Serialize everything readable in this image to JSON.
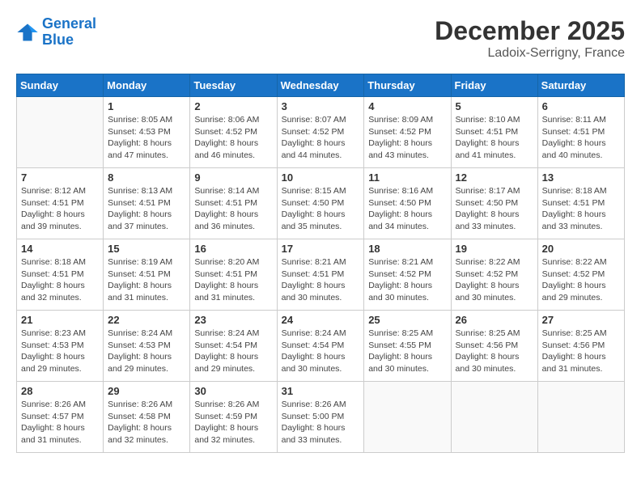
{
  "header": {
    "logo_line1": "General",
    "logo_line2": "Blue",
    "month": "December 2025",
    "location": "Ladoix-Serrigny, France"
  },
  "weekdays": [
    "Sunday",
    "Monday",
    "Tuesday",
    "Wednesday",
    "Thursday",
    "Friday",
    "Saturday"
  ],
  "weeks": [
    [
      {
        "day": "",
        "info": ""
      },
      {
        "day": "1",
        "info": "Sunrise: 8:05 AM\nSunset: 4:53 PM\nDaylight: 8 hours\nand 47 minutes."
      },
      {
        "day": "2",
        "info": "Sunrise: 8:06 AM\nSunset: 4:52 PM\nDaylight: 8 hours\nand 46 minutes."
      },
      {
        "day": "3",
        "info": "Sunrise: 8:07 AM\nSunset: 4:52 PM\nDaylight: 8 hours\nand 44 minutes."
      },
      {
        "day": "4",
        "info": "Sunrise: 8:09 AM\nSunset: 4:52 PM\nDaylight: 8 hours\nand 43 minutes."
      },
      {
        "day": "5",
        "info": "Sunrise: 8:10 AM\nSunset: 4:51 PM\nDaylight: 8 hours\nand 41 minutes."
      },
      {
        "day": "6",
        "info": "Sunrise: 8:11 AM\nSunset: 4:51 PM\nDaylight: 8 hours\nand 40 minutes."
      }
    ],
    [
      {
        "day": "7",
        "info": "Sunrise: 8:12 AM\nSunset: 4:51 PM\nDaylight: 8 hours\nand 39 minutes."
      },
      {
        "day": "8",
        "info": "Sunrise: 8:13 AM\nSunset: 4:51 PM\nDaylight: 8 hours\nand 37 minutes."
      },
      {
        "day": "9",
        "info": "Sunrise: 8:14 AM\nSunset: 4:51 PM\nDaylight: 8 hours\nand 36 minutes."
      },
      {
        "day": "10",
        "info": "Sunrise: 8:15 AM\nSunset: 4:50 PM\nDaylight: 8 hours\nand 35 minutes."
      },
      {
        "day": "11",
        "info": "Sunrise: 8:16 AM\nSunset: 4:50 PM\nDaylight: 8 hours\nand 34 minutes."
      },
      {
        "day": "12",
        "info": "Sunrise: 8:17 AM\nSunset: 4:50 PM\nDaylight: 8 hours\nand 33 minutes."
      },
      {
        "day": "13",
        "info": "Sunrise: 8:18 AM\nSunset: 4:51 PM\nDaylight: 8 hours\nand 33 minutes."
      }
    ],
    [
      {
        "day": "14",
        "info": "Sunrise: 8:18 AM\nSunset: 4:51 PM\nDaylight: 8 hours\nand 32 minutes."
      },
      {
        "day": "15",
        "info": "Sunrise: 8:19 AM\nSunset: 4:51 PM\nDaylight: 8 hours\nand 31 minutes."
      },
      {
        "day": "16",
        "info": "Sunrise: 8:20 AM\nSunset: 4:51 PM\nDaylight: 8 hours\nand 31 minutes."
      },
      {
        "day": "17",
        "info": "Sunrise: 8:21 AM\nSunset: 4:51 PM\nDaylight: 8 hours\nand 30 minutes."
      },
      {
        "day": "18",
        "info": "Sunrise: 8:21 AM\nSunset: 4:52 PM\nDaylight: 8 hours\nand 30 minutes."
      },
      {
        "day": "19",
        "info": "Sunrise: 8:22 AM\nSunset: 4:52 PM\nDaylight: 8 hours\nand 30 minutes."
      },
      {
        "day": "20",
        "info": "Sunrise: 8:22 AM\nSunset: 4:52 PM\nDaylight: 8 hours\nand 29 minutes."
      }
    ],
    [
      {
        "day": "21",
        "info": "Sunrise: 8:23 AM\nSunset: 4:53 PM\nDaylight: 8 hours\nand 29 minutes."
      },
      {
        "day": "22",
        "info": "Sunrise: 8:24 AM\nSunset: 4:53 PM\nDaylight: 8 hours\nand 29 minutes."
      },
      {
        "day": "23",
        "info": "Sunrise: 8:24 AM\nSunset: 4:54 PM\nDaylight: 8 hours\nand 29 minutes."
      },
      {
        "day": "24",
        "info": "Sunrise: 8:24 AM\nSunset: 4:54 PM\nDaylight: 8 hours\nand 30 minutes."
      },
      {
        "day": "25",
        "info": "Sunrise: 8:25 AM\nSunset: 4:55 PM\nDaylight: 8 hours\nand 30 minutes."
      },
      {
        "day": "26",
        "info": "Sunrise: 8:25 AM\nSunset: 4:56 PM\nDaylight: 8 hours\nand 30 minutes."
      },
      {
        "day": "27",
        "info": "Sunrise: 8:25 AM\nSunset: 4:56 PM\nDaylight: 8 hours\nand 31 minutes."
      }
    ],
    [
      {
        "day": "28",
        "info": "Sunrise: 8:26 AM\nSunset: 4:57 PM\nDaylight: 8 hours\nand 31 minutes."
      },
      {
        "day": "29",
        "info": "Sunrise: 8:26 AM\nSunset: 4:58 PM\nDaylight: 8 hours\nand 32 minutes."
      },
      {
        "day": "30",
        "info": "Sunrise: 8:26 AM\nSunset: 4:59 PM\nDaylight: 8 hours\nand 32 minutes."
      },
      {
        "day": "31",
        "info": "Sunrise: 8:26 AM\nSunset: 5:00 PM\nDaylight: 8 hours\nand 33 minutes."
      },
      {
        "day": "",
        "info": ""
      },
      {
        "day": "",
        "info": ""
      },
      {
        "day": "",
        "info": ""
      }
    ]
  ]
}
